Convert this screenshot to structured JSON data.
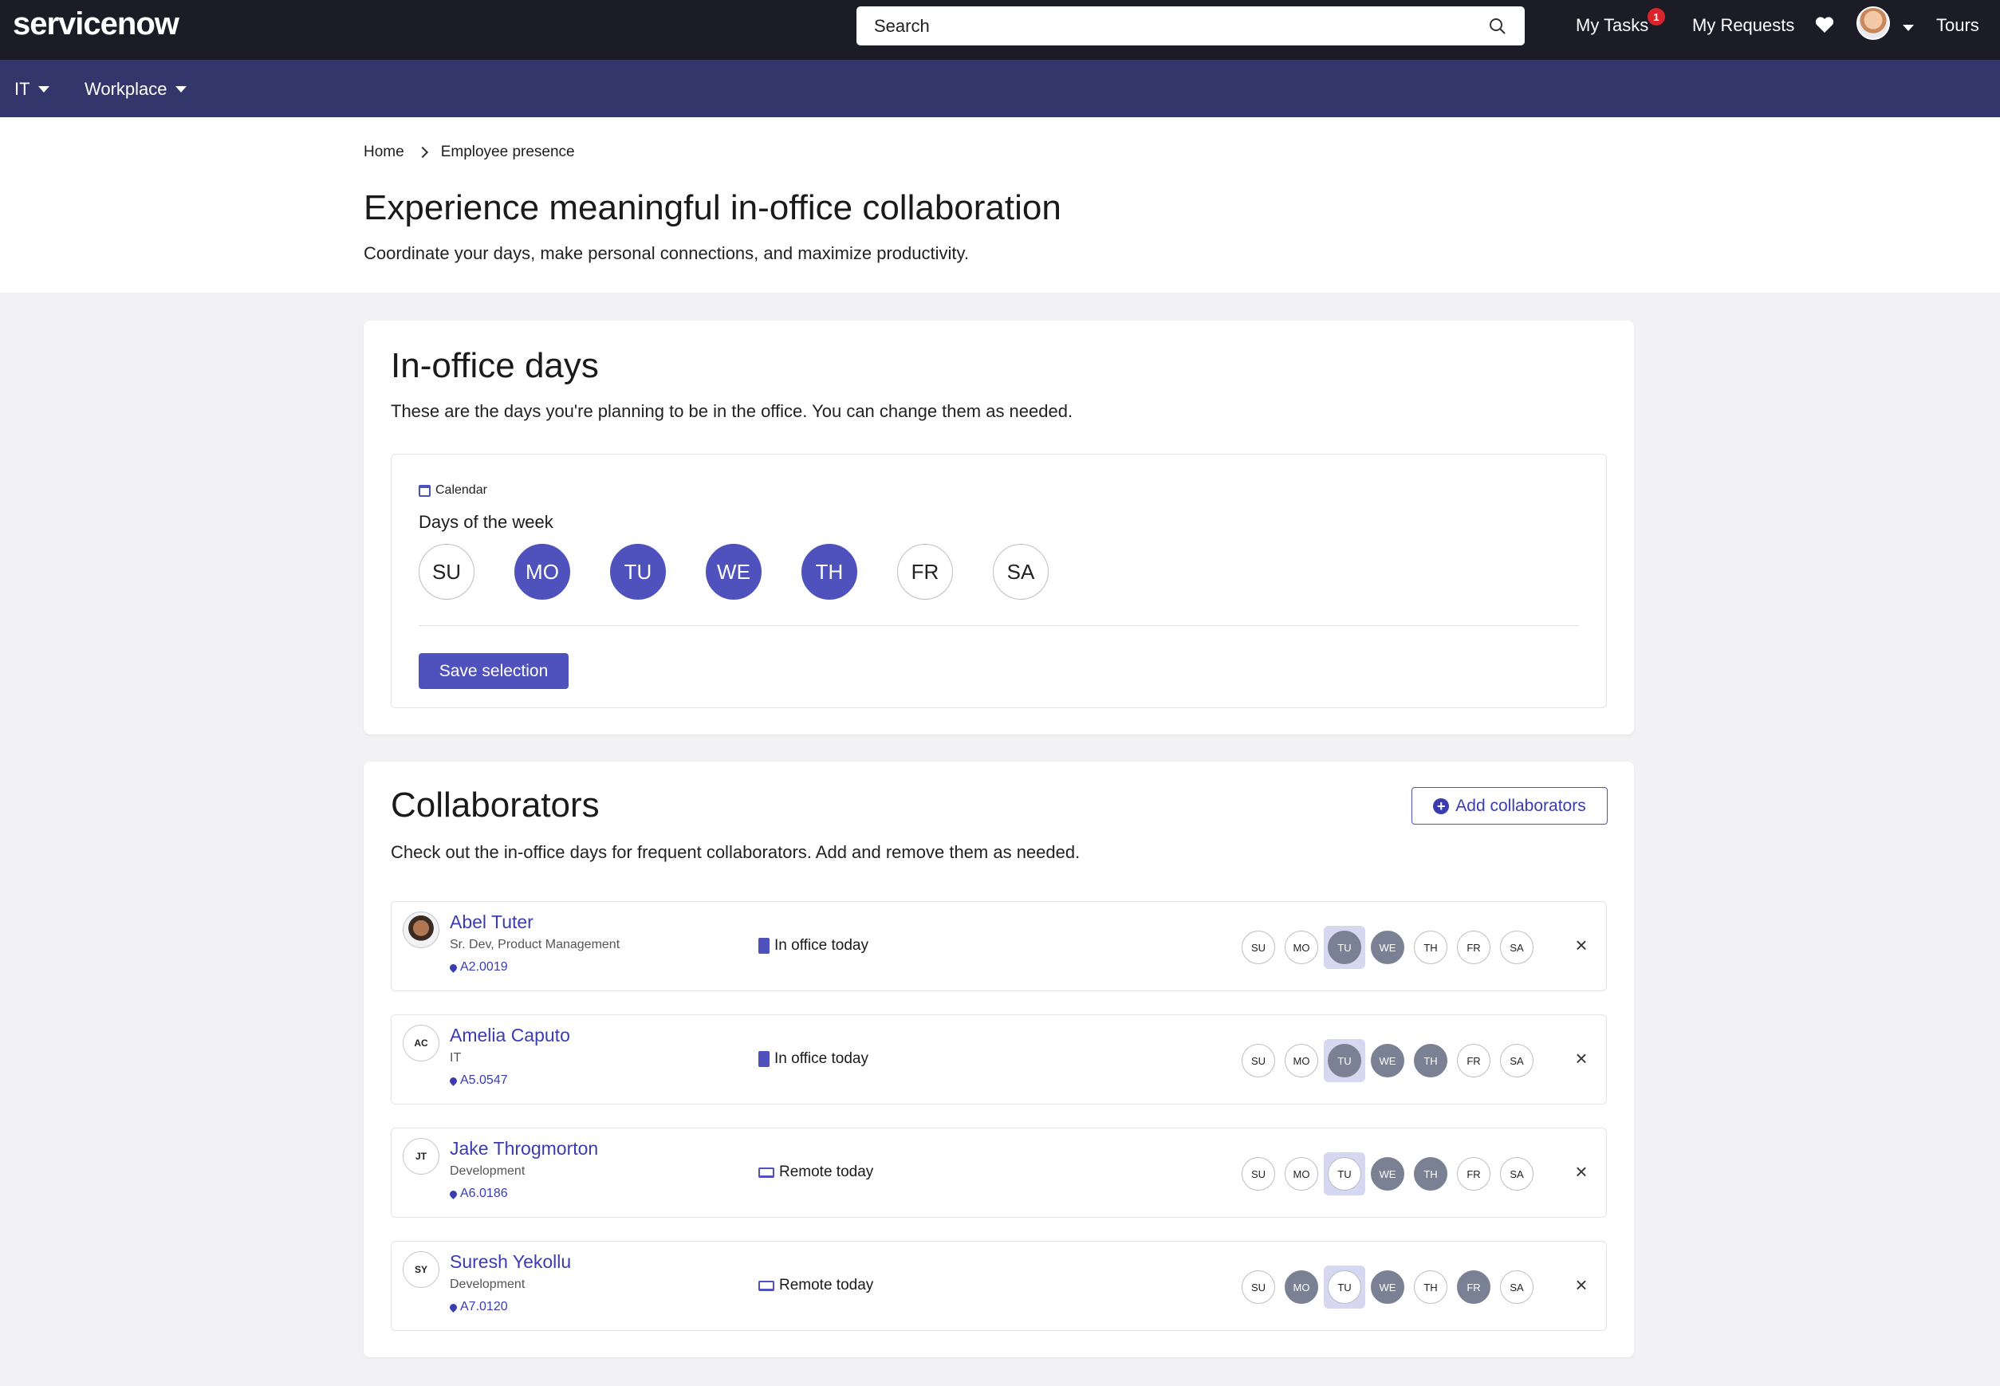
{
  "topbar": {
    "logo": "servicenow",
    "search_placeholder": "Search",
    "my_tasks": "My Tasks",
    "tasks_badge": "1",
    "my_requests": "My Requests",
    "tours": "Tours"
  },
  "subnav": {
    "it": "IT",
    "workplace": "Workplace"
  },
  "breadcrumb": {
    "home": "Home",
    "current": "Employee presence"
  },
  "page": {
    "title": "Experience meaningful in-office collaboration",
    "subtitle": "Coordinate your days, make personal connections, and maximize productivity."
  },
  "in_office": {
    "title": "In-office days",
    "description": "These are the days you're planning to be in the office. You can change them as needed.",
    "calendar_label": "Calendar",
    "days_label": "Days of the week",
    "days": [
      {
        "label": "SU",
        "selected": false
      },
      {
        "label": "MO",
        "selected": true
      },
      {
        "label": "TU",
        "selected": true
      },
      {
        "label": "WE",
        "selected": true
      },
      {
        "label": "TH",
        "selected": true
      },
      {
        "label": "FR",
        "selected": false
      },
      {
        "label": "SA",
        "selected": false
      }
    ],
    "save_label": "Save selection"
  },
  "collaborators": {
    "title": "Collaborators",
    "description": "Check out the in-office days for frequent collaborators. Add and remove them as needed.",
    "add_label": "Add collaborators",
    "today_index": 2,
    "people": [
      {
        "initials": "",
        "photo": true,
        "name": "Abel Tuter",
        "role": "Sr. Dev, Product Management",
        "location": "A2.0019",
        "status": "In office today",
        "status_icon": "office",
        "days": [
          0,
          0,
          1,
          1,
          0,
          0,
          0
        ]
      },
      {
        "initials": "AC",
        "photo": false,
        "name": "Amelia Caputo",
        "role": "IT",
        "location": "A5.0547",
        "status": "In office today",
        "status_icon": "office",
        "days": [
          0,
          0,
          1,
          1,
          1,
          0,
          0
        ]
      },
      {
        "initials": "JT",
        "photo": false,
        "name": "Jake Throgmorton",
        "role": "Development",
        "location": "A6.0186",
        "status": "Remote today",
        "status_icon": "remote",
        "days": [
          0,
          0,
          0,
          1,
          1,
          0,
          0
        ]
      },
      {
        "initials": "SY",
        "photo": false,
        "name": "Suresh Yekollu",
        "role": "Development",
        "location": "A7.0120",
        "status": "Remote today",
        "status_icon": "remote",
        "days": [
          0,
          1,
          0,
          1,
          0,
          1,
          0
        ]
      }
    ],
    "day_labels": [
      "SU",
      "MO",
      "TU",
      "WE",
      "TH",
      "FR",
      "SA"
    ]
  },
  "colors": {
    "accent": "#4f52bd",
    "topbar": "#1b1c26",
    "subnav": "#33366b",
    "day_on_small": "#7b8194"
  }
}
